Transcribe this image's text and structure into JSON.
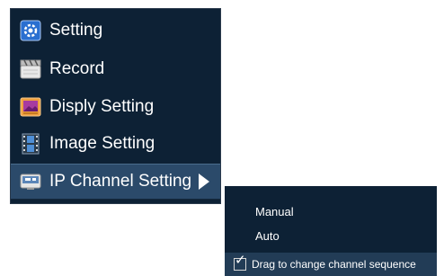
{
  "menu": {
    "items": [
      {
        "label": "Setting",
        "icon": "gear-icon"
      },
      {
        "label": "Record",
        "icon": "clapperboard-icon"
      },
      {
        "label": "Disply Setting",
        "icon": "monitor-icon"
      },
      {
        "label": "Image Setting",
        "icon": "film-strip-icon"
      },
      {
        "label": "IP Channel Setting",
        "icon": "ip-camera-icon",
        "active": true
      }
    ]
  },
  "submenu": {
    "items": [
      {
        "label": "Manual"
      },
      {
        "label": "Auto"
      },
      {
        "label": "Drag to change channel sequence",
        "checked": true
      }
    ]
  },
  "colors": {
    "menu_bg": "#0d2135",
    "active_bg": "#2b4a6a",
    "text": "#ffffff"
  }
}
